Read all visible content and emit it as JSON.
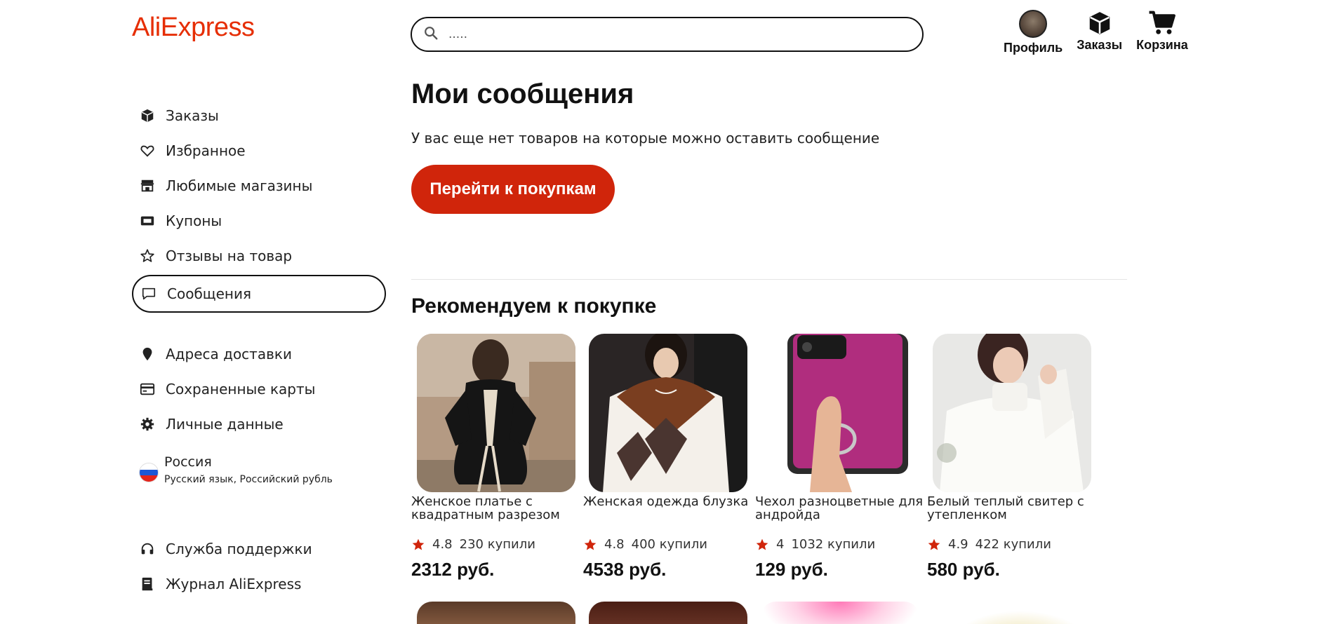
{
  "header": {
    "logo": "AliExpress",
    "search_placeholder": ".....",
    "nav": [
      {
        "label": "Профиль",
        "icon": "avatar"
      },
      {
        "label": "Заказы",
        "icon": "box-icon"
      },
      {
        "label": "Корзина",
        "icon": "cart-icon"
      }
    ]
  },
  "sidebar": {
    "items": [
      {
        "label": "Заказы",
        "icon": "box-icon"
      },
      {
        "label": "Избранное",
        "icon": "heart-icon"
      },
      {
        "label": "Любимые магазины",
        "icon": "store-icon"
      },
      {
        "label": "Купоны",
        "icon": "coupon-icon"
      },
      {
        "label": "Отзывы на товар",
        "icon": "star-outline-icon"
      },
      {
        "label": "Сообщения",
        "icon": "message-icon",
        "active": true
      },
      {
        "label": "Адреса доставки",
        "icon": "location-pin-icon"
      },
      {
        "label": "Сохраненные карты",
        "icon": "credit-card-icon"
      },
      {
        "label": "Личные данные",
        "icon": "gear-icon"
      }
    ],
    "locale": {
      "country": "Россия",
      "sub": "Русский язык, Российский рубль"
    },
    "bottom": [
      {
        "label": "Служба поддержки",
        "icon": "headphones-icon"
      },
      {
        "label": "Журнал AliExpress",
        "icon": "book-icon"
      }
    ]
  },
  "main": {
    "title": "Мои сообщения",
    "empty_text": "У вас еще нет товаров на которые можно оставить сообщение",
    "cta": "Перейти к покупкам",
    "rec_title": "Рекомендуем к покупке",
    "products": [
      {
        "name": "Женское платье с квадратным разрезом",
        "rating": "4.8",
        "sold": "230 купили",
        "price": "2312 руб."
      },
      {
        "name": "Женская одежда блузка",
        "rating": "4.8",
        "sold": "400 купили",
        "price": "4538 руб."
      },
      {
        "name": "Чехол разноцветные для андройда",
        "rating": "4",
        "sold": "1032 купили",
        "price": "129 руб."
      },
      {
        "name": "Белый теплый свитер с утепленком",
        "rating": "4.9",
        "sold": "422 купили",
        "price": "580 руб."
      }
    ]
  },
  "colors": {
    "accent": "#d0250b",
    "logo": "#e62e04",
    "star": "#d0250b"
  }
}
